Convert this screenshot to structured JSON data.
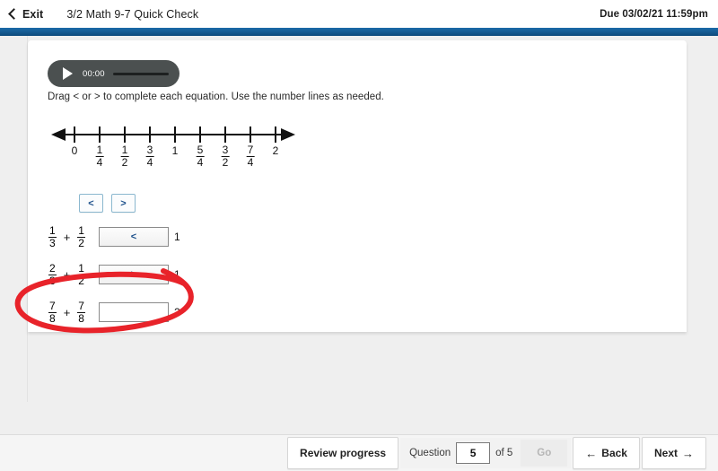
{
  "header": {
    "exit_label": "Exit",
    "assignment_title": "3/2 Math 9-7 Quick Check",
    "due_text": "Due 03/02/21 11:59pm",
    "accent_color": "#175d95"
  },
  "audio": {
    "play_label": "play",
    "time": "00:00"
  },
  "question": {
    "instructions": "Drag < or > to complete each equation. Use the number lines as needed.",
    "tokens": [
      {
        "label": "<"
      },
      {
        "label": ">"
      }
    ],
    "number_line": {
      "labels": [
        {
          "whole": "0"
        },
        {
          "num": "1",
          "den": "4"
        },
        {
          "num": "1",
          "den": "2"
        },
        {
          "num": "3",
          "den": "4"
        },
        {
          "whole": "1"
        },
        {
          "num": "5",
          "den": "4"
        },
        {
          "num": "3",
          "den": "2"
        },
        {
          "num": "7",
          "den": "4"
        },
        {
          "whole": "2"
        }
      ]
    },
    "equations": [
      {
        "left_num": "1",
        "left_den": "3",
        "operator": "+",
        "right_num": "1",
        "right_den": "2",
        "answer": "<",
        "compare_to": "1"
      },
      {
        "left_num": "2",
        "left_den": "3",
        "operator": "+",
        "right_num": "1",
        "right_den": "2",
        "answer": ">",
        "compare_to": "1"
      },
      {
        "left_num": "7",
        "left_den": "8",
        "operator": "+",
        "right_num": "7",
        "right_den": "8",
        "answer": "",
        "compare_to": "2"
      }
    ]
  },
  "annotation": {
    "color": "#e8232a",
    "shape": "hand-drawn-ellipse"
  },
  "footer": {
    "review_label": "Review progress",
    "question_label": "Question",
    "question_value": "5",
    "of_label": "of 5",
    "go_label": "Go",
    "back_label": "Back",
    "next_label": "Next"
  }
}
